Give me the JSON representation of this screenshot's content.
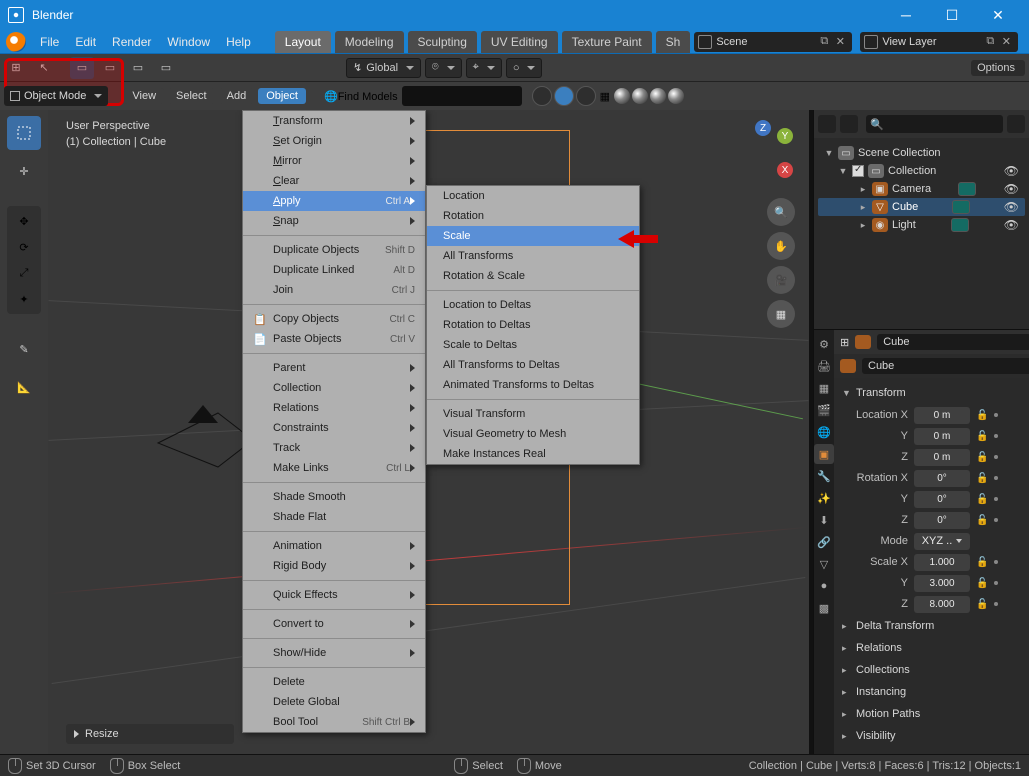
{
  "app_title": "Blender",
  "menubar": [
    "File",
    "Edit",
    "Render",
    "Window",
    "Help"
  ],
  "workspace_tabs": [
    "Layout",
    "Modeling",
    "Sculpting",
    "UV Editing",
    "Texture Paint",
    "Sh"
  ],
  "active_workspace": "Layout",
  "scene_field": "Scene",
  "viewlayer_field": "View Layer",
  "orientation_dd": "Global",
  "options_label": "Options",
  "mode_label": "Object Mode",
  "sub_buttons": [
    "View",
    "Select",
    "Add",
    "Object"
  ],
  "find_models_label": "Find Models",
  "vp_info": {
    "line1": "User Perspective",
    "line2": "(1) Collection | Cube"
  },
  "resize_label": "Resize",
  "object_menu": [
    {
      "label": "Transform",
      "underline": "T",
      "sub": true
    },
    {
      "label": "Set Origin",
      "underline": "S",
      "sub": true
    },
    {
      "label": "Mirror",
      "underline": "M",
      "sub": true
    },
    {
      "label": "Clear",
      "underline": "C",
      "sub": true
    },
    {
      "label": "Apply",
      "underline": "A",
      "short": "Ctrl A",
      "sub": true,
      "hi": true
    },
    {
      "label": "Snap",
      "underline": "S",
      "sub": true
    },
    {
      "sep": true
    },
    {
      "label": "Duplicate Objects",
      "short": "Shift D"
    },
    {
      "label": "Duplicate Linked",
      "short": "Alt D"
    },
    {
      "label": "Join",
      "short": "Ctrl J"
    },
    {
      "sep": true
    },
    {
      "icon": "📋",
      "label": "Copy Objects",
      "short": "Ctrl C"
    },
    {
      "icon": "📄",
      "label": "Paste Objects",
      "short": "Ctrl V"
    },
    {
      "sep": true
    },
    {
      "label": "Parent",
      "sub": true
    },
    {
      "label": "Collection",
      "sub": true
    },
    {
      "label": "Relations",
      "sub": true
    },
    {
      "label": "Constraints",
      "sub": true
    },
    {
      "label": "Track",
      "sub": true
    },
    {
      "label": "Make Links",
      "short": "Ctrl L",
      "sub": true
    },
    {
      "sep": true
    },
    {
      "label": "Shade Smooth"
    },
    {
      "label": "Shade Flat"
    },
    {
      "sep": true
    },
    {
      "label": "Animation",
      "sub": true
    },
    {
      "label": "Rigid Body",
      "sub": true
    },
    {
      "sep": true
    },
    {
      "label": "Quick Effects",
      "sub": true
    },
    {
      "sep": true
    },
    {
      "label": "Convert to",
      "sub": true
    },
    {
      "sep": true
    },
    {
      "label": "Show/Hide",
      "sub": true
    },
    {
      "sep": true
    },
    {
      "label": "Delete"
    },
    {
      "label": "Delete Global"
    },
    {
      "label": "Bool Tool",
      "short": "Shift Ctrl B",
      "sub": true
    }
  ],
  "apply_submenu": {
    "groups": [
      [
        "Location",
        "Rotation",
        "Scale",
        "All Transforms",
        "Rotation & Scale"
      ],
      [
        "Location to Deltas",
        "Rotation to Deltas",
        "Scale to Deltas",
        "All Transforms to Deltas",
        "Animated Transforms to Deltas"
      ],
      [
        "Visual Transform",
        "Visual Geometry to Mesh",
        "Make Instances Real"
      ]
    ],
    "highlight": "Scale"
  },
  "outliner": {
    "root": "Scene Collection",
    "collection": "Collection",
    "items": [
      {
        "name": "Camera",
        "icon": "cam"
      },
      {
        "name": "Cube",
        "icon": "mesh",
        "selected": true
      },
      {
        "name": "Light",
        "icon": "light"
      }
    ]
  },
  "properties": {
    "object_name": "Cube",
    "transform_title": "Transform",
    "location": {
      "X": "0 m",
      "Y": "0 m",
      "Z": "0 m"
    },
    "rotation": {
      "X": "0°",
      "Y": "0°",
      "Z": "0°"
    },
    "rotation_mode": "XYZ ..",
    "scale": {
      "X": "1.000",
      "Y": "3.000",
      "Z": "8.000"
    },
    "sections": [
      "Delta Transform",
      "Relations",
      "Collections",
      "Instancing",
      "Motion Paths",
      "Visibility"
    ]
  },
  "status": {
    "left1": "Set 3D Cursor",
    "left2": "Box Select",
    "mid1": "Select",
    "mid2": "Move",
    "right": "Collection | Cube | Verts:8 | Faces:6 | Tris:12 | Objects:1"
  }
}
